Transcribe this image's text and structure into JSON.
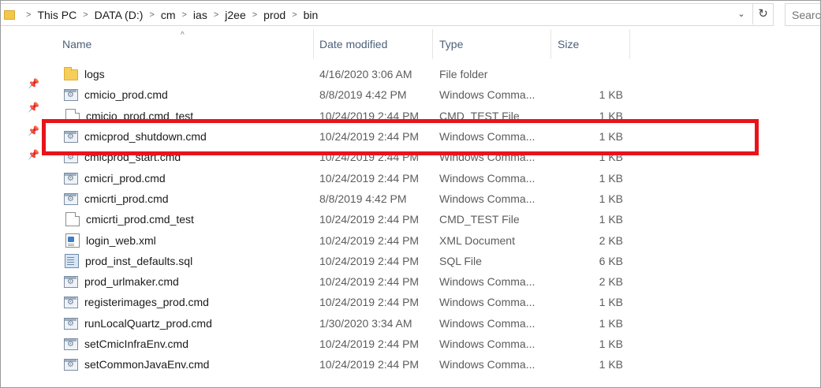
{
  "address_bar": {
    "breadcrumbs": [
      "This PC",
      "DATA (D:)",
      "cm",
      "ias",
      "j2ee",
      "prod",
      "bin"
    ],
    "dropdown_icon": "chevron-down-icon",
    "refresh_icon": "refresh-icon"
  },
  "search": {
    "placeholder": "Search bin"
  },
  "columns": {
    "name": "Name",
    "date_modified": "Date modified",
    "type": "Type",
    "size": "Size",
    "sort_indicator": "^"
  },
  "files": [
    {
      "name": "logs",
      "date": "4/16/2020 3:06 AM",
      "type": "File folder",
      "size": "",
      "icon": "folder"
    },
    {
      "name": "cmicio_prod.cmd",
      "date": "8/8/2019 4:42 PM",
      "type": "Windows Comma...",
      "size": "1 KB",
      "icon": "cmd"
    },
    {
      "name": "cmicio_prod.cmd_test",
      "date": "10/24/2019 2:44 PM",
      "type": "CMD_TEST File",
      "size": "1 KB",
      "icon": "doc"
    },
    {
      "name": "cmicprod_shutdown.cmd",
      "date": "10/24/2019 2:44 PM",
      "type": "Windows Comma...",
      "size": "1 KB",
      "icon": "cmd"
    },
    {
      "name": "cmicprod_start.cmd",
      "date": "10/24/2019 2:44 PM",
      "type": "Windows Comma...",
      "size": "1 KB",
      "icon": "cmd"
    },
    {
      "name": "cmicri_prod.cmd",
      "date": "10/24/2019 2:44 PM",
      "type": "Windows Comma...",
      "size": "1 KB",
      "icon": "cmd"
    },
    {
      "name": "cmicrti_prod.cmd",
      "date": "8/8/2019 4:42 PM",
      "type": "Windows Comma...",
      "size": "1 KB",
      "icon": "cmd"
    },
    {
      "name": "cmicrti_prod.cmd_test",
      "date": "10/24/2019 2:44 PM",
      "type": "CMD_TEST File",
      "size": "1 KB",
      "icon": "doc"
    },
    {
      "name": "login_web.xml",
      "date": "10/24/2019 2:44 PM",
      "type": "XML Document",
      "size": "2 KB",
      "icon": "xml"
    },
    {
      "name": "prod_inst_defaults.sql",
      "date": "10/24/2019 2:44 PM",
      "type": "SQL File",
      "size": "6 KB",
      "icon": "sql"
    },
    {
      "name": "prod_urlmaker.cmd",
      "date": "10/24/2019 2:44 PM",
      "type": "Windows Comma...",
      "size": "2 KB",
      "icon": "cmd"
    },
    {
      "name": "registerimages_prod.cmd",
      "date": "10/24/2019 2:44 PM",
      "type": "Windows Comma...",
      "size": "1 KB",
      "icon": "cmd"
    },
    {
      "name": "runLocalQuartz_prod.cmd",
      "date": "1/30/2020 3:34 AM",
      "type": "Windows Comma...",
      "size": "1 KB",
      "icon": "cmd"
    },
    {
      "name": "setCmicInfraEnv.cmd",
      "date": "10/24/2019 2:44 PM",
      "type": "Windows Comma...",
      "size": "1 KB",
      "icon": "cmd"
    },
    {
      "name": "setCommonJavaEnv.cmd",
      "date": "10/24/2019 2:44 PM",
      "type": "Windows Comma...",
      "size": "1 KB",
      "icon": "cmd"
    }
  ],
  "highlight": {
    "row": "cmicprod_shutdown.cmd",
    "color": "#e8141b"
  },
  "pins": [
    "pin-icon",
    "pin-icon",
    "pin-icon",
    "pin-icon"
  ]
}
